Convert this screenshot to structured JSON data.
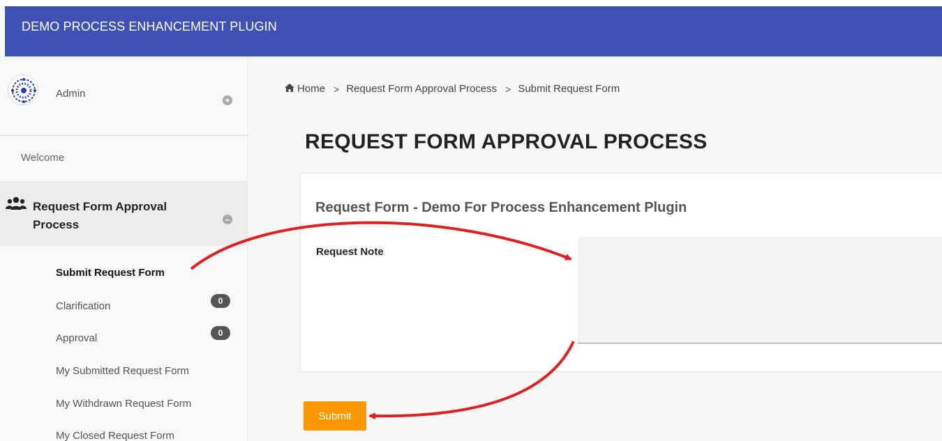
{
  "app": {
    "title": "DEMO PROCESS ENHANCEMENT PLUGIN",
    "accent": "#3f51b5"
  },
  "sidebar": {
    "user": {
      "name": "Admin"
    },
    "welcome": "Welcome",
    "section": {
      "title": "Request Form Approval Process"
    },
    "items": [
      {
        "label": "Submit Request Form",
        "active": true
      },
      {
        "label": "Clarification",
        "badge": "0"
      },
      {
        "label": "Approval",
        "badge": "0"
      },
      {
        "label": "My Submitted Request Form"
      },
      {
        "label": "My Withdrawn Request Form"
      },
      {
        "label": "My Closed Request Form"
      }
    ]
  },
  "breadcrumb": {
    "home": "Home",
    "items": [
      "Request Form Approval Process",
      "Submit Request Form"
    ],
    "separator": ">"
  },
  "page": {
    "title": "REQUEST FORM APPROVAL PROCESS"
  },
  "form": {
    "title": "Request Form - Demo For Process Enhancement Plugin",
    "field_label": "Request Note",
    "field_value": "",
    "submit_label": "Submit",
    "submit_color": "#ff9800"
  },
  "annotation": {
    "arrow_color": "#e02020"
  }
}
